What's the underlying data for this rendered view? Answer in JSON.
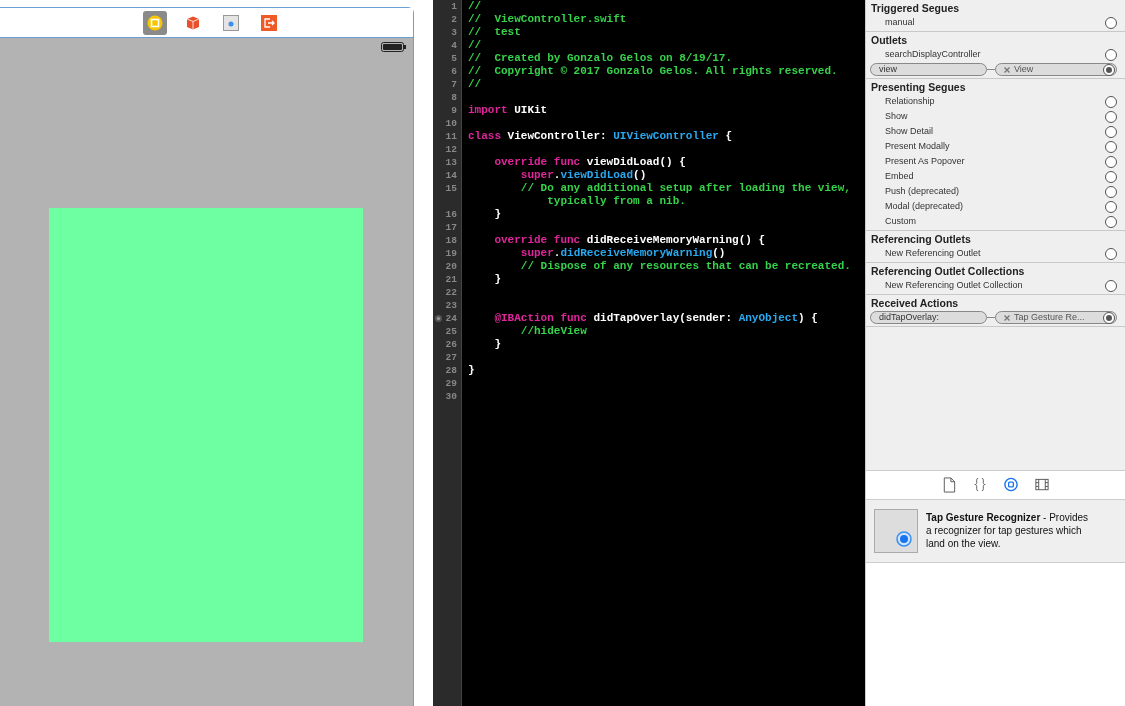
{
  "scene": {
    "dock_icons": [
      {
        "kind": "controller",
        "selected": true
      },
      {
        "kind": "responder",
        "selected": false
      },
      {
        "kind": "gesture",
        "selected": false
      },
      {
        "kind": "exit",
        "selected": false
      }
    ]
  },
  "code": {
    "lines": [
      {
        "number": "1",
        "connected": false,
        "tokens": [
          {
            "kind": "comment",
            "text": "//"
          }
        ]
      },
      {
        "number": "2",
        "connected": false,
        "tokens": [
          {
            "kind": "comment",
            "text": "//  ViewController.swift"
          }
        ]
      },
      {
        "number": "3",
        "connected": false,
        "tokens": [
          {
            "kind": "comment",
            "text": "//  test"
          }
        ]
      },
      {
        "number": "4",
        "connected": false,
        "tokens": [
          {
            "kind": "comment",
            "text": "//"
          }
        ]
      },
      {
        "number": "5",
        "connected": false,
        "tokens": [
          {
            "kind": "comment",
            "text": "//  Created by Gonzalo Gelos on 8/19/17."
          }
        ]
      },
      {
        "number": "6",
        "connected": false,
        "tokens": [
          {
            "kind": "comment",
            "text": "//  Copyright © 2017 Gonzalo Gelos. All rights reserved."
          }
        ]
      },
      {
        "number": "7",
        "connected": false,
        "tokens": [
          {
            "kind": "comment",
            "text": "//"
          }
        ]
      },
      {
        "number": "8",
        "connected": false
      },
      {
        "number": "9",
        "connected": false,
        "tokens": [
          {
            "kind": "keyword",
            "text": "import"
          },
          {
            "kind": "plain",
            "text": " UIKit"
          }
        ]
      },
      {
        "number": "10",
        "connected": false
      },
      {
        "number": "11",
        "connected": false,
        "tokens": [
          {
            "kind": "keyword",
            "text": "class"
          },
          {
            "kind": "plain",
            "text": " ViewController: "
          },
          {
            "kind": "type",
            "text": "UIViewController"
          },
          {
            "kind": "plain",
            "text": " {"
          }
        ]
      },
      {
        "number": "12",
        "connected": false
      },
      {
        "number": "13",
        "connected": false,
        "tokens": [
          {
            "kind": "keyword",
            "text": "    override func"
          },
          {
            "kind": "plain",
            "text": " viewDidLoad() {"
          }
        ]
      },
      {
        "number": "14",
        "connected": false,
        "tokens": [
          {
            "kind": "keyword",
            "text": "        super"
          },
          {
            "kind": "plain",
            "text": "."
          },
          {
            "kind": "type",
            "text": "viewDidLoad"
          },
          {
            "kind": "plain",
            "text": "()"
          }
        ]
      },
      {
        "number": "15",
        "connected": false,
        "tokens": [
          {
            "kind": "comment",
            "text": "        // Do any additional setup after loading the view,"
          }
        ],
        "continuation": [
          {
            "kind": "comment",
            "text": "            typically from a nib."
          }
        ]
      },
      {
        "number": "16",
        "connected": false,
        "tokens": [
          {
            "kind": "plain",
            "text": "    }"
          }
        ]
      },
      {
        "number": "17",
        "connected": false
      },
      {
        "number": "18",
        "connected": false,
        "tokens": [
          {
            "kind": "keyword",
            "text": "    override func"
          },
          {
            "kind": "plain",
            "text": " didReceiveMemoryWarning() {"
          }
        ]
      },
      {
        "number": "19",
        "connected": false,
        "tokens": [
          {
            "kind": "keyword",
            "text": "        super"
          },
          {
            "kind": "plain",
            "text": "."
          },
          {
            "kind": "type",
            "text": "didReceiveMemoryWarning"
          },
          {
            "kind": "plain",
            "text": "()"
          }
        ]
      },
      {
        "number": "20",
        "connected": false,
        "tokens": [
          {
            "kind": "comment",
            "text": "        // Dispose of any resources that can be recreated."
          }
        ]
      },
      {
        "number": "21",
        "connected": false,
        "tokens": [
          {
            "kind": "plain",
            "text": "    }"
          }
        ]
      },
      {
        "number": "22",
        "connected": false
      },
      {
        "number": "23",
        "connected": false
      },
      {
        "number": "24",
        "connected": true,
        "tokens": [
          {
            "kind": "keyword",
            "text": "    @IBAction func"
          },
          {
            "kind": "plain",
            "text": " didTapOverlay(sender: "
          },
          {
            "kind": "type",
            "text": "AnyObject"
          },
          {
            "kind": "plain",
            "text": ") {"
          }
        ]
      },
      {
        "number": "25",
        "connected": false,
        "tokens": [
          {
            "kind": "comment",
            "text": "        //hideView"
          }
        ]
      },
      {
        "number": "26",
        "connected": false,
        "tokens": [
          {
            "kind": "plain",
            "text": "    }"
          }
        ]
      },
      {
        "number": "27",
        "connected": false
      },
      {
        "number": "28",
        "connected": false,
        "tokens": [
          {
            "kind": "plain",
            "text": "}"
          }
        ]
      },
      {
        "number": "29",
        "connected": false
      },
      {
        "number": "30",
        "connected": false
      }
    ]
  },
  "connections": {
    "sections": [
      {
        "title": "Triggered Segues",
        "items": [
          {
            "label": "manual",
            "connected": false
          }
        ]
      },
      {
        "title": "Outlets",
        "items": [
          {
            "label": "searchDisplayController",
            "connected": false
          },
          {
            "label": "view",
            "connected": true,
            "target": "View"
          }
        ]
      },
      {
        "title": "Presenting Segues",
        "items": [
          {
            "label": "Relationship",
            "connected": false
          },
          {
            "label": "Show",
            "connected": false
          },
          {
            "label": "Show Detail",
            "connected": false
          },
          {
            "label": "Present Modally",
            "connected": false
          },
          {
            "label": "Present As Popover",
            "connected": false
          },
          {
            "label": "Embed",
            "connected": false
          },
          {
            "label": "Push (deprecated)",
            "connected": false
          },
          {
            "label": "Modal (deprecated)",
            "connected": false
          },
          {
            "label": "Custom",
            "connected": false
          }
        ]
      },
      {
        "title": "Referencing Outlets",
        "items": [
          {
            "label": "New Referencing Outlet",
            "connected": false
          }
        ]
      },
      {
        "title": "Referencing Outlet Collections",
        "items": [
          {
            "label": "New Referencing Outlet Collection",
            "connected": false
          }
        ]
      },
      {
        "title": "Received Actions",
        "items": [
          {
            "label": "didTapOverlay:",
            "connected": true,
            "target": "Tap Gesture Re..."
          }
        ]
      }
    ]
  },
  "library_tabs": [
    {
      "kind": "file",
      "selected": false
    },
    {
      "kind": "code",
      "selected": false
    },
    {
      "kind": "object",
      "selected": true
    },
    {
      "kind": "media",
      "selected": false
    }
  ],
  "library_item": {
    "description": "**Tap Gesture Recognizer** - Provides a recognizer for tap gestures which land on the view."
  }
}
